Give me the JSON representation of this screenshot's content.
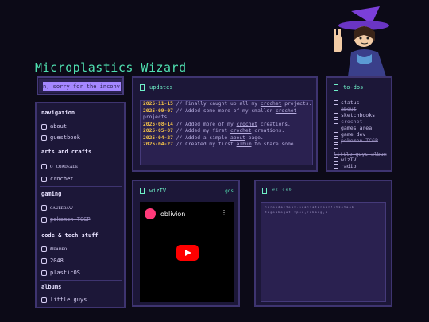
{
  "site": {
    "title": "Microplastics Wizard"
  },
  "marquee": {
    "text": "n, sorry for the inconv"
  },
  "nav": {
    "sections": [
      {
        "heading": "navigation",
        "items": [
          {
            "label": "about",
            "icon": "star-icon",
            "strike": false
          },
          {
            "label": "guestbook",
            "icon": "book-icon",
            "strike": false
          }
        ]
      },
      {
        "heading": "arts and crafts",
        "items": [
          {
            "label": "ᴏ ᴄᴏᴀᴅᴇᴀᴅᴇ",
            "icon": "palette-icon",
            "strike": false
          },
          {
            "label": "crochet",
            "icon": "yarn-icon",
            "strike": false
          }
        ]
      },
      {
        "heading": "gaming",
        "items": [
          {
            "label": "ᴄᴀᴜᴇᴇᴏᴀᴡ",
            "icon": "controller-icon",
            "strike": false
          },
          {
            "label": "pokemon TCGP",
            "icon": "card-icon",
            "strike": true
          }
        ]
      },
      {
        "heading": "code & tech stuff",
        "items": [
          {
            "label": "ʍᴇᴀᴅᴇᴏ",
            "icon": "code-icon",
            "strike": false
          },
          {
            "label": "2048",
            "icon": "grid-icon",
            "strike": false
          },
          {
            "label": "plasticOS",
            "icon": "monitor-icon",
            "strike": false
          }
        ]
      },
      {
        "heading": "albums",
        "items": [
          {
            "label": "little guys",
            "icon": "face-icon",
            "strike": false
          }
        ]
      }
    ]
  },
  "updates": {
    "title": "updates",
    "rows": [
      {
        "date": "2025-11-15",
        "text": "// Finally caught up all my ",
        "link": "crochet",
        "rest": " projects."
      },
      {
        "date": "2025-09-07",
        "text": "// Added some more of my smaller ",
        "link": "crochet",
        "rest": " projects."
      },
      {
        "date": "2025-08-14",
        "text": "// Added more of my ",
        "link": "crochet",
        "rest": " creations."
      },
      {
        "date": "2025-05-07",
        "text": "// Added my first ",
        "link": "crochet",
        "rest": " creations."
      },
      {
        "date": "2025-04-27",
        "text": "// Added a simple ",
        "link": "about",
        "rest": " page."
      },
      {
        "date": "2025-04-27",
        "text": "// Created my first ",
        "link": "album",
        "rest": " to share some"
      }
    ]
  },
  "todo": {
    "title": "to-dos",
    "items": [
      {
        "label": "status",
        "done": false
      },
      {
        "label": "about",
        "done": true
      },
      {
        "label": "sketchbooks",
        "done": false
      },
      {
        "label": "crochet",
        "done": true
      },
      {
        "label": "games area",
        "done": false
      },
      {
        "label": "game dev",
        "done": false
      },
      {
        "label": "pokemon TCGP",
        "done": true
      },
      {
        "label": "little guys album",
        "done": true
      },
      {
        "label": "wizTV",
        "done": false
      },
      {
        "label": "radio",
        "done": false
      }
    ]
  },
  "wiztv": {
    "title": "wizTV",
    "tag": "gos",
    "video_title": "oblivion",
    "menu": "⋮"
  },
  "chat": {
    "title": "ʷᶦ·ᶜᵉᵇ",
    "text": "ᵔᵃᵔᵒᵒᵈᵃᵔᵗᵒᵃᵔ·ᵖᵒᵃᵔᵔᵃᵗᵉᵔᵒᵃᵔ'ᵖᵗᶦᵉᵗᵉᵒᵇ ᵗᵉᵍᵒᵃᵇᵒᵍᵉᵗ ˈᵖᵉᵒ·ʳᵒᵇᵃᵃᵍ·ᵒ"
  }
}
